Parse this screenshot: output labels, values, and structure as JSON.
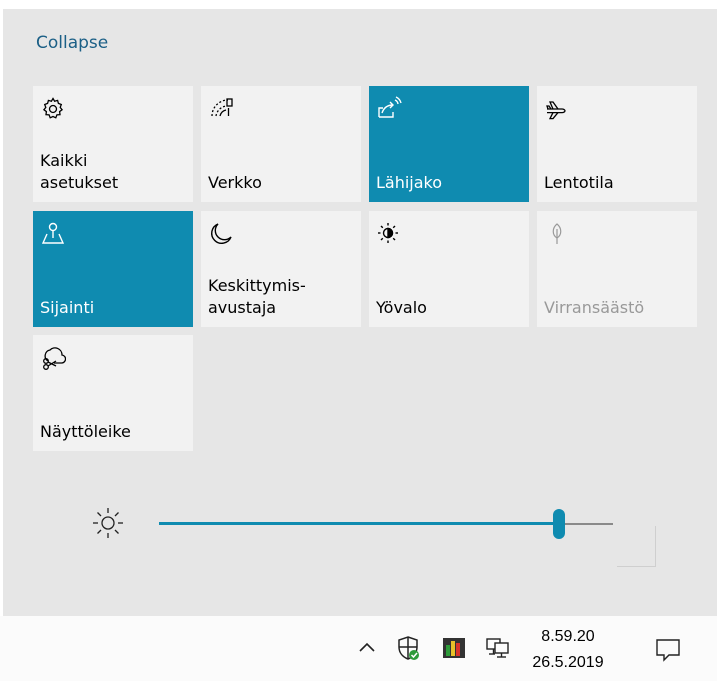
{
  "panel": {
    "collapse_label": "Collapse"
  },
  "tiles": [
    {
      "label": "Kaikki\nasetukset",
      "icon": "gear-icon",
      "state": "normal"
    },
    {
      "label": "Verkko",
      "icon": "network-icon",
      "state": "normal"
    },
    {
      "label": "Lähijako",
      "icon": "nearby-share-icon",
      "state": "active"
    },
    {
      "label": "Lentotila",
      "icon": "airplane-icon",
      "state": "normal"
    },
    {
      "label": "Sijainti",
      "icon": "location-icon",
      "state": "active"
    },
    {
      "label": "Keskittymis-\navustaja",
      "icon": "moon-icon",
      "state": "normal"
    },
    {
      "label": "Yövalo",
      "icon": "night-light-icon",
      "state": "normal"
    },
    {
      "label": "Virransäästö",
      "icon": "battery-saver-icon",
      "state": "disabled"
    },
    {
      "label": "Näyttöleike",
      "icon": "snip-icon",
      "state": "normal"
    }
  ],
  "brightness": {
    "icon": "brightness-icon",
    "level": 0.88
  },
  "taskbar": {
    "time": "8.59.20",
    "date": "26.5.2019",
    "tray_icons": [
      "chevron-up-icon",
      "defender-icon",
      "app-bars-icon",
      "network-wired-icon"
    ],
    "notification_icon": "notification-icon"
  },
  "colors": {
    "accent": "#0f8bb0",
    "panel_bg": "#e6e6e6",
    "tile_bg": "#f2f2f2",
    "link": "#1b5f86"
  }
}
